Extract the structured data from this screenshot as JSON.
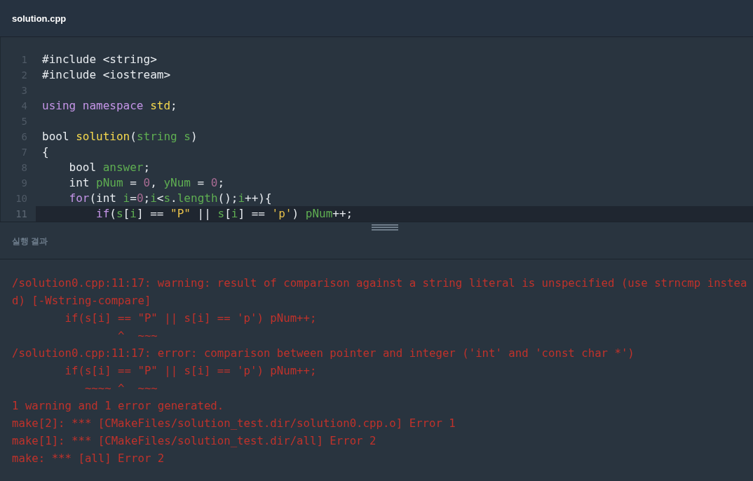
{
  "editor": {
    "filename": "solution.cpp",
    "lines": [
      {
        "number": "1",
        "highlighted": false,
        "tokens": [
          {
            "kind": "plain",
            "text": "#include <string>"
          }
        ]
      },
      {
        "number": "2",
        "highlighted": false,
        "tokens": [
          {
            "kind": "plain",
            "text": "#include <iostream>"
          }
        ]
      },
      {
        "number": "3",
        "highlighted": false
      },
      {
        "number": "4",
        "highlighted": false,
        "tokens": [
          {
            "kind": "keyword",
            "text": "using namespace "
          },
          {
            "kind": "function",
            "text": "std"
          },
          {
            "kind": "plain",
            "text": ";"
          }
        ]
      },
      {
        "number": "5",
        "highlighted": false
      },
      {
        "number": "6",
        "highlighted": false,
        "tokens": [
          {
            "kind": "plain",
            "text": "bool "
          },
          {
            "kind": "function",
            "text": "solution"
          },
          {
            "kind": "plain",
            "text": "("
          },
          {
            "kind": "variable",
            "text": "string s"
          },
          {
            "kind": "plain",
            "text": ")"
          }
        ]
      },
      {
        "number": "7",
        "highlighted": false,
        "tokens": [
          {
            "kind": "plain",
            "text": "{"
          }
        ]
      },
      {
        "number": "8",
        "highlighted": false,
        "tokens": [
          {
            "kind": "plain",
            "text": "    bool "
          },
          {
            "kind": "variable",
            "text": "answer"
          },
          {
            "kind": "plain",
            "text": ";"
          }
        ]
      },
      {
        "number": "9",
        "highlighted": false,
        "tokens": [
          {
            "kind": "plain",
            "text": "    int "
          },
          {
            "kind": "variable",
            "text": "pNum"
          },
          {
            "kind": "plain",
            "text": " = "
          },
          {
            "kind": "number",
            "text": "0"
          },
          {
            "kind": "plain",
            "text": ", "
          },
          {
            "kind": "variable",
            "text": "yNum"
          },
          {
            "kind": "plain",
            "text": " = "
          },
          {
            "kind": "number",
            "text": "0"
          },
          {
            "kind": "plain",
            "text": ";"
          }
        ]
      },
      {
        "number": "10",
        "highlighted": false,
        "tokens": [
          {
            "kind": "keyword",
            "text": "    for"
          },
          {
            "kind": "plain",
            "text": "(int "
          },
          {
            "kind": "variable",
            "text": "i"
          },
          {
            "kind": "plain",
            "text": "="
          },
          {
            "kind": "number",
            "text": "0"
          },
          {
            "kind": "plain",
            "text": ";"
          },
          {
            "kind": "variable",
            "text": "i"
          },
          {
            "kind": "plain",
            "text": "<"
          },
          {
            "kind": "variable",
            "text": "s"
          },
          {
            "kind": "plain",
            "text": "."
          },
          {
            "kind": "variable",
            "text": "length"
          },
          {
            "kind": "plain",
            "text": "();"
          },
          {
            "kind": "variable",
            "text": "i"
          },
          {
            "kind": "plain",
            "text": "++){"
          }
        ]
      },
      {
        "number": "11",
        "highlighted": true,
        "tokens": [
          {
            "kind": "keyword",
            "text": "        if"
          },
          {
            "kind": "plain",
            "text": "("
          },
          {
            "kind": "variable",
            "text": "s"
          },
          {
            "kind": "plain",
            "text": "["
          },
          {
            "kind": "variable",
            "text": "i"
          },
          {
            "kind": "plain",
            "text": "] == "
          },
          {
            "kind": "string",
            "text": "\"P\""
          },
          {
            "kind": "plain",
            "text": " || "
          },
          {
            "kind": "variable",
            "text": "s"
          },
          {
            "kind": "plain",
            "text": "["
          },
          {
            "kind": "variable",
            "text": "i"
          },
          {
            "kind": "plain",
            "text": "] == "
          },
          {
            "kind": "string",
            "text": "'p'"
          },
          {
            "kind": "plain",
            "text": ") "
          },
          {
            "kind": "variable",
            "text": "pNum"
          },
          {
            "kind": "plain",
            "text": "++;"
          }
        ]
      }
    ]
  },
  "output": {
    "title": "실행 결과",
    "lines": [
      "/solution0.cpp:11:17: warning: result of comparison against a string literal is unspecified (use strncmp instea",
      "d) [-Wstring-compare]",
      "        if(s[i] == \"P\" || s[i] == 'p') pNum++;",
      "                ^  ~~~",
      "/solution0.cpp:11:17: error: comparison between pointer and integer ('int' and 'const char *')",
      "        if(s[i] == \"P\" || s[i] == 'p') pNum++;",
      "           ~~~~ ^  ~~~",
      "1 warning and 1 error generated.",
      "make[2]: *** [CMakeFiles/solution_test.dir/solution0.cpp.o] Error 1",
      "make[1]: *** [CMakeFiles/solution_test.dir/all] Error 2",
      "make: *** [all] Error 2"
    ]
  }
}
